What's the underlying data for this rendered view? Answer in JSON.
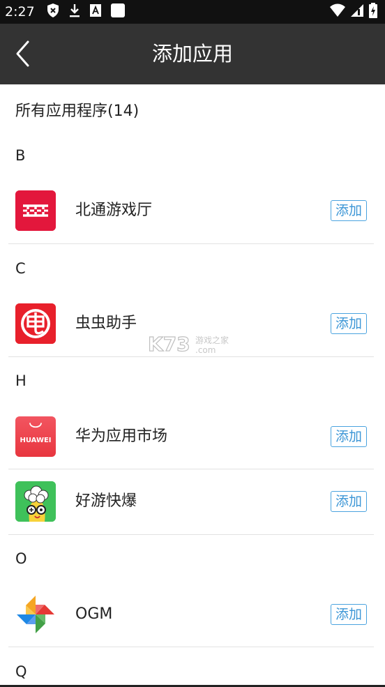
{
  "status_bar": {
    "time": "2:27",
    "left_icons": [
      "shield-x-icon",
      "download-icon",
      "a-square-icon",
      "white-square-icon"
    ],
    "right_icons": [
      "wifi-icon",
      "signal-icon",
      "battery-charging-icon"
    ]
  },
  "header": {
    "title": "添加应用",
    "back_icon": "chevron-left-icon"
  },
  "section_header": {
    "label": "所有应用程序(14)"
  },
  "groups": [
    {
      "letter": "B",
      "apps": [
        {
          "name": "北通游戏厅",
          "action": "添加",
          "icon": "beitong-icon",
          "color": "#e3173c"
        }
      ]
    },
    {
      "letter": "C",
      "apps": [
        {
          "name": "虫虫助手",
          "action": "添加",
          "icon": "chongchong-icon",
          "color": "#e8202b"
        }
      ]
    },
    {
      "letter": "H",
      "apps": [
        {
          "name": "华为应用市场",
          "action": "添加",
          "icon": "huawei-appgallery-icon",
          "color": "#f0404e",
          "icon_text": "HUAWEI"
        },
        {
          "name": "好游快爆",
          "action": "添加",
          "icon": "haoyou-icon",
          "color": "#3fc15a"
        }
      ]
    },
    {
      "letter": "O",
      "apps": [
        {
          "name": "OGM",
          "action": "添加",
          "icon": "pinwheel-icon",
          "color": "#f5a623"
        }
      ]
    },
    {
      "letter": "Q",
      "apps": []
    }
  ],
  "watermark": {
    "brand": "K73",
    "sub_top": "游戏之家",
    "sub_bottom": ".com"
  },
  "accent_color": "#3c96d6"
}
